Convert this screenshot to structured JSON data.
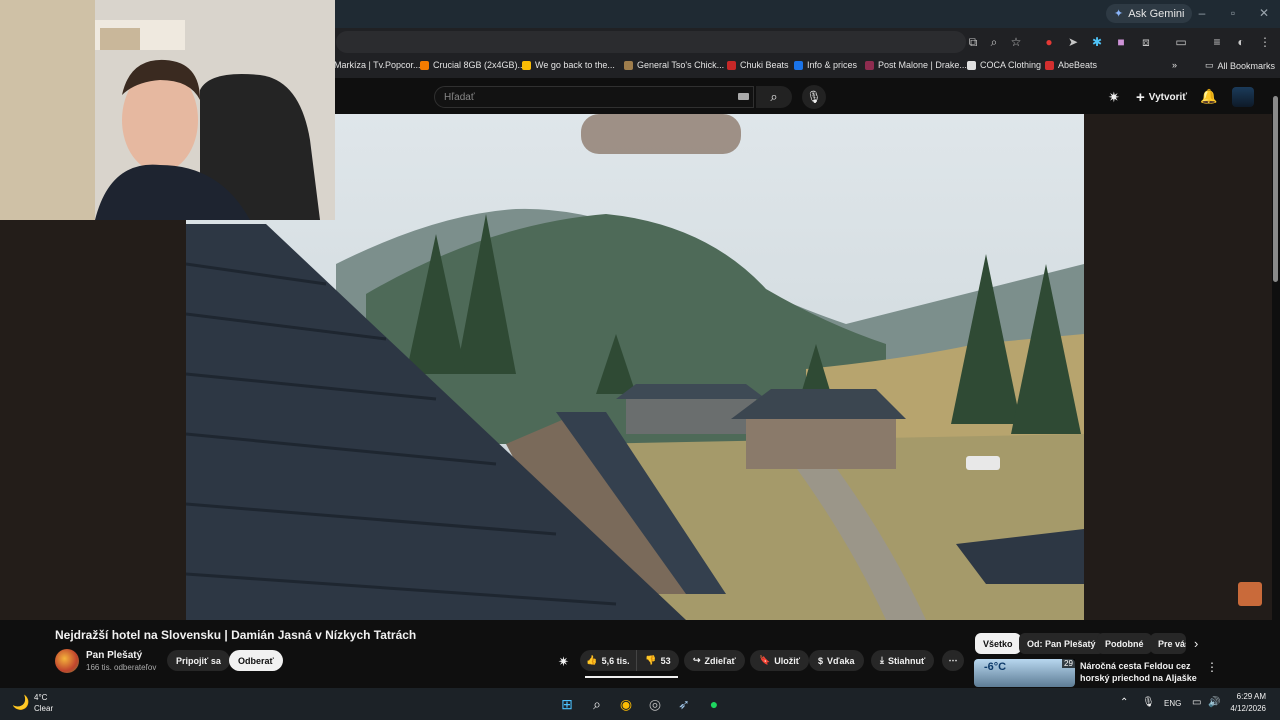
{
  "browser": {
    "gemini_label": "Ask Gemini",
    "bookmarks": [
      {
        "label": "Markíza | Tv.Popcor...",
        "color": "#1e88e5"
      },
      {
        "label": "Crucial 8GB (2x4GB)...",
        "color": "#f57c00"
      },
      {
        "label": "We go back to the...",
        "color": "#fbbc04"
      },
      {
        "label": "General Tso's Chick...",
        "color": "#9e7d4c"
      },
      {
        "label": "Chuki Beats",
        "color": "#c62828"
      },
      {
        "label": "Info & prices",
        "color": "#1a73e8"
      },
      {
        "label": "Post Malone | Drake...",
        "color": "#8e2c4f"
      },
      {
        "label": "COCA Clothing",
        "color": "#e0e0e0"
      },
      {
        "label": "AbeBeats",
        "color": "#d32f2f"
      }
    ],
    "all_bookmarks": "All Bookmarks"
  },
  "youtube": {
    "search_placeholder": "Hľadať",
    "create_label": "Vytvoriť"
  },
  "video": {
    "title": "Nejdražší hotel na Slovensku | Damián Jasná v Nízkych Tatrách",
    "channel": "Pan Plešatý",
    "subscribers": "166 tis. odberateľov",
    "join_label": "Pripojiť sa",
    "subscribe_label": "Odberať",
    "likes": "5,6 tis.",
    "dislikes": "53",
    "share_label": "Zdieľať",
    "save_label": "Uložiť",
    "thanks_label": "Vďaka",
    "download_label": "Stiahnuť"
  },
  "recommendations": {
    "chips": [
      "Všetko",
      "Od: Pan Plešatý",
      "Podobné",
      "Pre vás"
    ],
    "active_chip": 0,
    "first": {
      "title": "Náročná cesta Feldou cez horský priechod na Aljaške na ...",
      "duration": "29",
      "thumb_text": "-6°C"
    }
  },
  "taskbar": {
    "weather_temp": "4°C",
    "weather_desc": "Clear",
    "language": "ENG",
    "time": "6:29 AM",
    "date": "4/12/2026"
  }
}
